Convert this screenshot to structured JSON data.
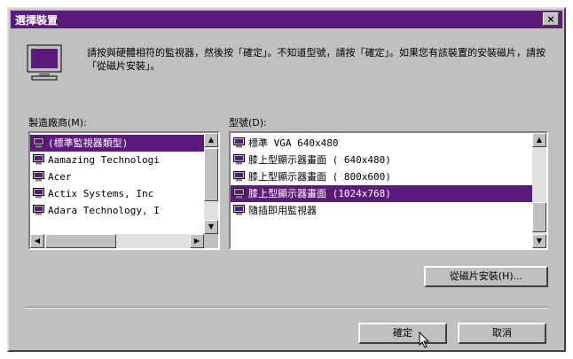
{
  "window": {
    "title": "選擇裝置",
    "close_glyph": "×",
    "instruction": "請按與硬體相符的監視器，然後按「確定」。不知道型號，請按「確定」。如果您有該裝置的安裝磁片，請按「從磁片安裝」。"
  },
  "manufacturers": {
    "label": "製造廠商(M):",
    "items": [
      {
        "label": "(標準監視器類型)",
        "selected": true
      },
      {
        "label": "Aamazing Technologi"
      },
      {
        "label": "Acer"
      },
      {
        "label": "Actix Systems, Inc"
      },
      {
        "label": "Adara Technology, I"
      }
    ]
  },
  "models": {
    "label": "型號(D):",
    "items": [
      {
        "label": "標準 VGA 640x480"
      },
      {
        "label": "膝上型顯示器畫面 ( 640x480)"
      },
      {
        "label": "膝上型顯示器畫面 ( 800x600)"
      },
      {
        "label": "膝上型顯示器畫面 (1024x768)",
        "selected": true
      },
      {
        "label": "隨插即用監視器"
      }
    ]
  },
  "buttons": {
    "have_disk": "從磁片安裝(H)...",
    "ok": "確定",
    "cancel": "取消"
  },
  "colors": {
    "accent": "#5c1a7a",
    "face": "#c0c0c0"
  }
}
